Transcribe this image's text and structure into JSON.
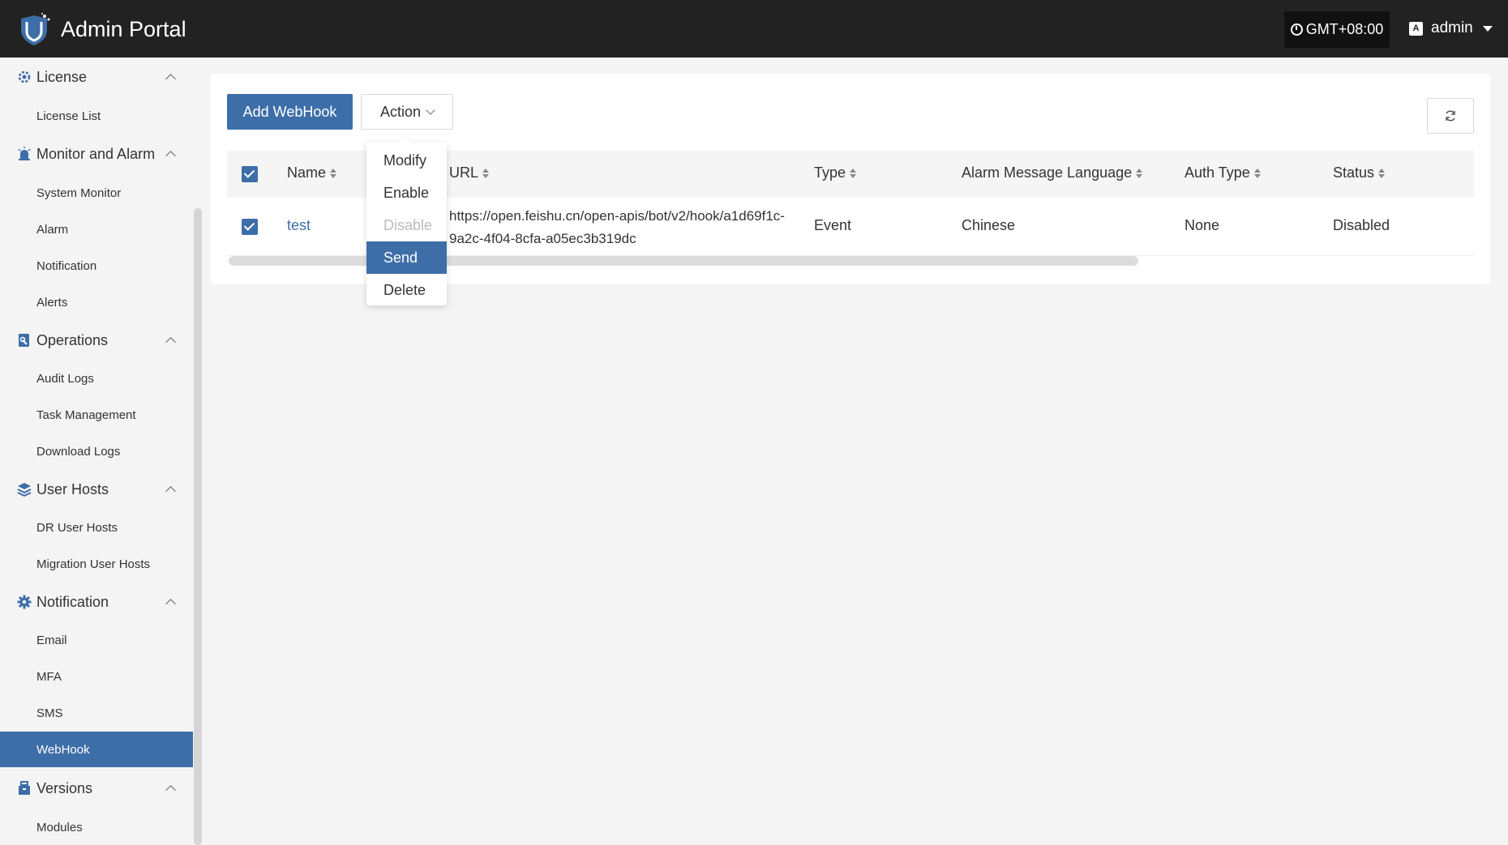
{
  "header": {
    "app_title": "Admin Portal",
    "timezone": "GMT+08:00",
    "user": "admin",
    "brand_color": "#3e6ea8"
  },
  "sidebar": {
    "groups": [
      {
        "label": "License",
        "icon": "license-icon",
        "items": [
          "License List"
        ]
      },
      {
        "label": "Monitor and Alarm",
        "icon": "alarm-icon",
        "items": [
          "System Monitor",
          "Alarm",
          "Notification",
          "Alerts"
        ]
      },
      {
        "label": "Operations",
        "icon": "operations-icon",
        "items": [
          "Audit Logs",
          "Task Management",
          "Download Logs"
        ]
      },
      {
        "label": "User Hosts",
        "icon": "layers-icon",
        "items": [
          "DR User Hosts",
          "Migration User Hosts"
        ]
      },
      {
        "label": "Notification",
        "icon": "gear-icon",
        "items": [
          "Email",
          "MFA",
          "SMS",
          "WebHook"
        ]
      },
      {
        "label": "Versions",
        "icon": "package-icon",
        "items": [
          "Modules"
        ]
      }
    ],
    "active_item": "WebHook"
  },
  "toolbar": {
    "add_label": "Add WebHook",
    "action_label": "Action"
  },
  "action_menu": {
    "items": [
      "Modify",
      "Enable",
      "Disable",
      "Send",
      "Delete"
    ],
    "disabled": [
      "Disable"
    ],
    "highlighted": "Send"
  },
  "table": {
    "columns": [
      "Name",
      "URL",
      "Type",
      "Alarm Message Language",
      "Auth Type",
      "Status"
    ],
    "rows": [
      {
        "name": "test",
        "url": "https://open.feishu.cn/open-apis/bot/v2/hook/a1d69f1c-9a2c-4f04-8cfa-a05ec3b319dc",
        "type": "Event",
        "language": "Chinese",
        "auth_type": "None",
        "status": "Disabled"
      }
    ]
  }
}
